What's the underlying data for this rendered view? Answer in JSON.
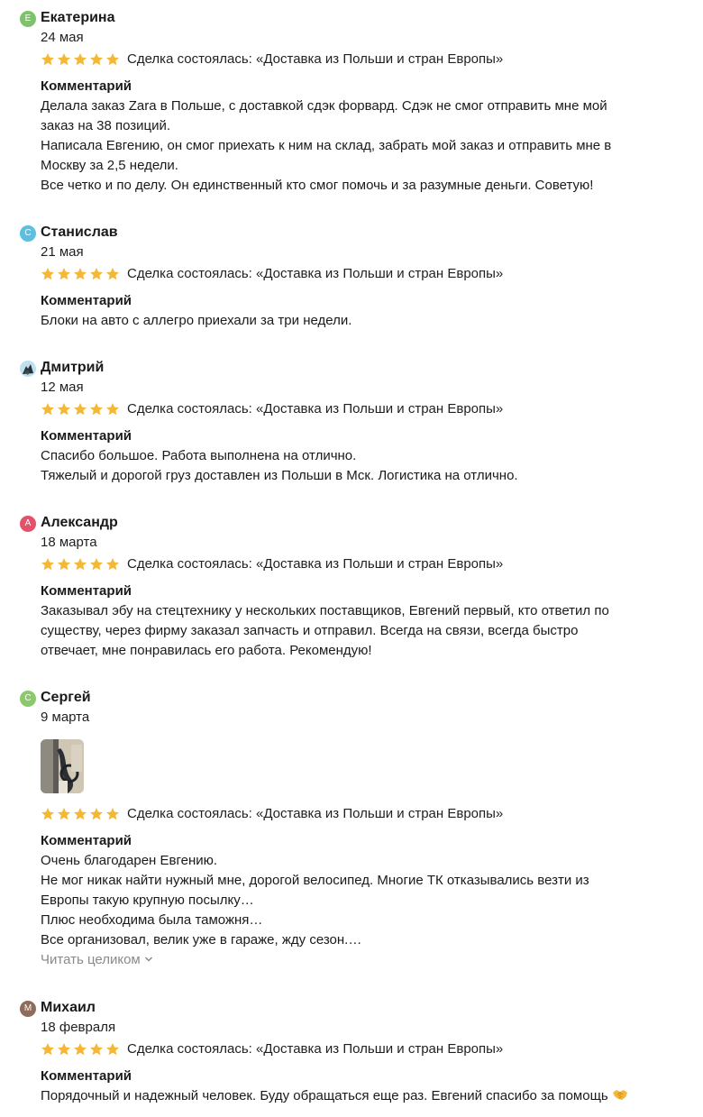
{
  "colors": {
    "star": "#f5b836",
    "avatar_e": "#7cc36a",
    "avatar_s": "#5bc0e0",
    "avatar_a": "#e3516b",
    "avatar_sergey": "#8cc96d",
    "avatar_m": "#8f6b5a"
  },
  "reviews": [
    {
      "author": "Екатерина",
      "initial": "Е",
      "date": "24 мая",
      "rating": 5,
      "deal": "Сделка состоялась: «Доставка из Польши и стран Европы»",
      "comment_label": "Комментарий",
      "lines": [
        "Делала заказ Zara в Польше, с доставкой сдэк форвард. Сдэк не смог отправить мне мой",
        "заказ на 38 позиций.",
        "Написала Евгению, он смог приехать к ним на склад, забрать мой заказ и отправить мне в",
        "Москву за 2,5 недели.",
        "Все четко и по делу. Он единственный кто смог помочь и за разумные деньги. Советую!"
      ]
    },
    {
      "author": "Станислав",
      "initial": "С",
      "date": "21 мая",
      "rating": 5,
      "deal": "Сделка состоялась: «Доставка из Польши и стран Европы»",
      "comment_label": "Комментарий",
      "lines": [
        "Блоки на авто с аллегро приехали за три недели."
      ]
    },
    {
      "author": "Дмитрий",
      "initial": "",
      "date": "12 мая",
      "rating": 5,
      "deal": "Сделка состоялась: «Доставка из Польши и стран Европы»",
      "comment_label": "Комментарий",
      "lines": [
        "Спасибо большое. Работа выполнена на отлично.",
        "Тяжелый и дорогой груз доставлен из Польши в Мск. Логистика на отлично."
      ]
    },
    {
      "author": "Александр",
      "initial": "А",
      "date": "18 марта",
      "rating": 5,
      "deal": "Сделка состоялась: «Доставка из Польши и стран Европы»",
      "comment_label": "Комментарий",
      "lines": [
        "Заказывал эбу на стецтехнику у нескольких поставщиков, Евгений первый, кто ответил по",
        "существу, через фирму заказал запчасть и отправил. Всегда на связи, всегда быстро",
        "отвечает, мне понравилась его работа. Рекомендую!"
      ]
    },
    {
      "author": "Сергей",
      "initial": "С",
      "date": "9 марта",
      "rating": 5,
      "deal": "Сделка состоялась: «Доставка из Польши и стран Европы»",
      "comment_label": "Комментарий",
      "lines": [
        "Очень благодарен Евгению.",
        "Не мог никак найти нужный мне, дорогой велосипед. Многие ТК отказывались везти из",
        "Европы такую крупную посылку…",
        "Плюс необходима была таможня…",
        "Все организовал, велик уже в гараже, жду сезон.…"
      ],
      "read_more": "Читать целиком"
    },
    {
      "author": "Михаил",
      "initial": "М",
      "date": "18 февраля",
      "rating": 5,
      "deal": "Сделка состоялась: «Доставка из Польши и стран Европы»",
      "comment_label": "Комментарий",
      "lines": [
        "Порядочный и надежный человек. Буду обращаться еще раз. Евгений спасибо за помощь"
      ]
    }
  ]
}
